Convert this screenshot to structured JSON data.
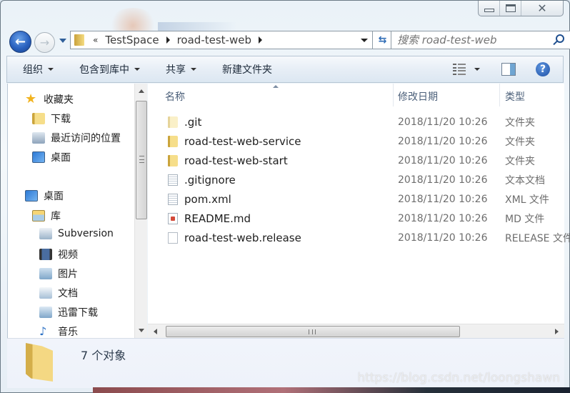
{
  "window": {
    "controls": {
      "minimize": "minimize",
      "maximize": "maximize",
      "close": "close"
    }
  },
  "nav": {
    "back_icon": "back-arrow-icon",
    "forward_icon": "forward-arrow-icon",
    "overflow": "«",
    "breadcrumbs": [
      "TestSpace",
      "road-test-web"
    ],
    "search_placeholder": "搜索 road-test-web"
  },
  "toolbar": {
    "organize": "组织",
    "include_in_library": "包含到库中",
    "share": "共享",
    "new_folder": "新建文件夹"
  },
  "sidebar": {
    "favorites": {
      "label": "收藏夹",
      "items": [
        "下载",
        "最近访问的位置",
        "桌面"
      ]
    },
    "desktop": "桌面",
    "libraries": {
      "label": "库",
      "items": [
        "Subversion",
        "视频",
        "图片",
        "文档",
        "迅雷下载",
        "音乐"
      ]
    }
  },
  "columns": {
    "name": "名称",
    "modified": "修改日期",
    "type": "类型"
  },
  "files": [
    {
      "name": ".git",
      "modified": "2018/11/20 10:26",
      "type": "文件夹",
      "icon": "folder-hidden"
    },
    {
      "name": "road-test-web-service",
      "modified": "2018/11/20 10:26",
      "type": "文件夹",
      "icon": "folder"
    },
    {
      "name": "road-test-web-start",
      "modified": "2018/11/20 10:26",
      "type": "文件夹",
      "icon": "folder"
    },
    {
      "name": ".gitignore",
      "modified": "2018/11/20 10:26",
      "type": "文本文档",
      "icon": "text"
    },
    {
      "name": "pom.xml",
      "modified": "2018/11/20 10:26",
      "type": "XML 文件",
      "icon": "text"
    },
    {
      "name": "README.md",
      "modified": "2018/11/20 10:26",
      "type": "MD 文件",
      "icon": "md"
    },
    {
      "name": "road-test-web.release",
      "modified": "2018/11/20 10:26",
      "type": "RELEASE 文件",
      "icon": "blank"
    }
  ],
  "details": {
    "count": "7 个对象"
  },
  "watermark": "https://blog.csdn.net/loongshawn"
}
